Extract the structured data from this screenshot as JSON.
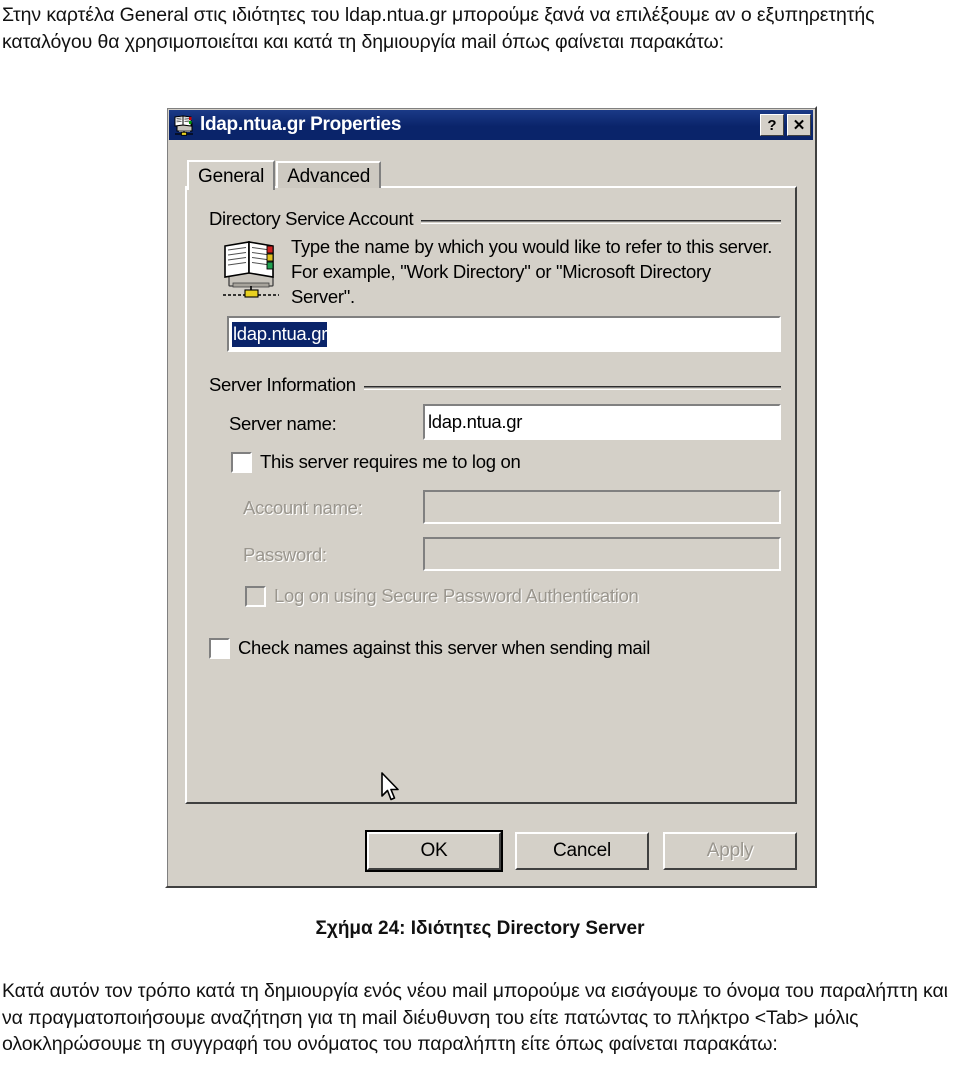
{
  "document": {
    "intro_paragraph": "Στην καρτέλα General στις ιδιότητες του ldap.ntua.gr μπορούμε ξανά να επιλέξουμε αν ο εξυπηρετητής καταλόγου θα χρησιμοποιείται και κατά τη δημιουργία mail όπως φαίνεται παρακάτω:",
    "figure_caption": "Σχήμα 24: Ιδιότητες Directory Server",
    "outro_paragraph": "Κατά αυτόν τον τρόπο κατά τη δημιουργία ενός νέου mail μπορούμε να εισάγουμε το όνομα του παραλήπτη και να πραγματοποιήσουμε αναζήτηση για τη mail διέυθυνση του είτε πατώντας το πλήκτρο <Tab> μόλις ολοκληρώσουμε τη συγγραφή του ονόματος του παραλήπτη είτε όπως φαίνεται παρακάτω:"
  },
  "dialog": {
    "title": "ldap.ntua.gr Properties",
    "help_button": "?",
    "close_button": "✕",
    "tabs": [
      {
        "label": "General",
        "active": true
      },
      {
        "label": "Advanced",
        "active": false
      }
    ],
    "account_group": {
      "legend": "Directory Service Account",
      "description": "Type the name by which you would like to refer to this server. For example, \"Work Directory\" or \"Microsoft Directory Server\".",
      "display_name_value": "ldap.ntua.gr"
    },
    "server_group": {
      "legend": "Server Information",
      "server_name_label": "Server name:",
      "server_name_value": "ldap.ntua.gr",
      "requires_logon_label": "This server requires me to log on",
      "requires_logon_checked": false,
      "account_name_label": "Account name:",
      "account_name_value": "",
      "password_label": "Password:",
      "password_value": "",
      "spa_label": "Log on using Secure Password Authentication",
      "spa_checked": false,
      "check_names_label": "Check names against this server when sending mail",
      "check_names_checked": false
    },
    "buttons": {
      "ok": "OK",
      "cancel": "Cancel",
      "apply": "Apply"
    }
  },
  "colors": {
    "titlebar": "#0a246a",
    "dialog_face": "#d4d0c8",
    "selection": "#0a246a",
    "disabled_text": "#9a968e"
  }
}
